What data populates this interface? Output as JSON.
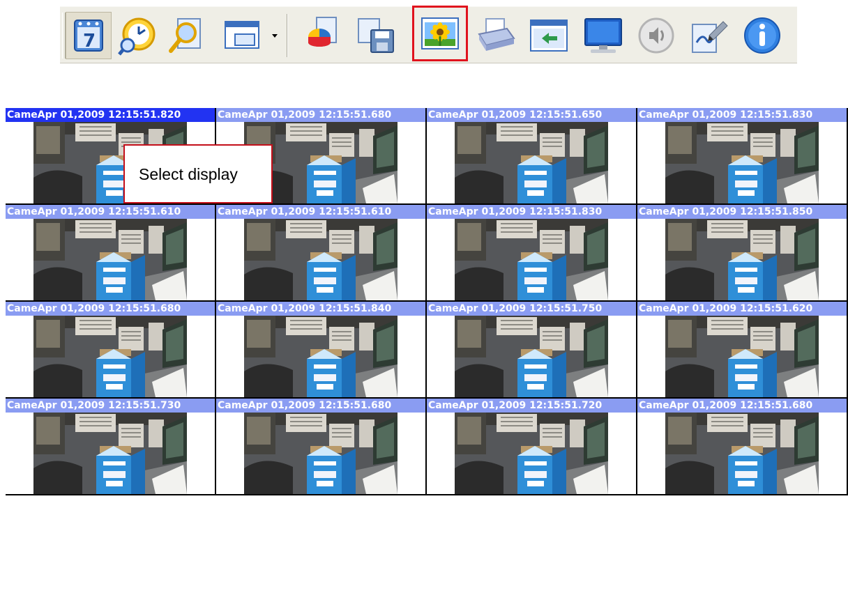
{
  "toolbar": {
    "buttons": [
      {
        "name": "calendar-playback-button",
        "icon": "calendar-icon",
        "state": "pressed"
      },
      {
        "name": "time-search-button",
        "icon": "clock-search-icon",
        "state": "normal"
      },
      {
        "name": "file-search-button",
        "icon": "magnifier-icon",
        "state": "normal"
      },
      {
        "name": "split-screen-button",
        "icon": "window-layout-icon",
        "state": "normal",
        "has_dropdown": true
      },
      {
        "name": "statistics-button",
        "icon": "pie-chart-icon",
        "state": "normal"
      },
      {
        "name": "backup-button",
        "icon": "save-disk-icon",
        "state": "normal"
      },
      {
        "name": "select-display-button",
        "icon": "sunflower-image-icon",
        "state": "highlighted"
      },
      {
        "name": "print-button",
        "icon": "printer-icon",
        "state": "normal"
      },
      {
        "name": "return-button",
        "icon": "return-arrow-icon",
        "state": "normal"
      },
      {
        "name": "monitor-button",
        "icon": "monitor-icon",
        "state": "normal"
      },
      {
        "name": "audio-button",
        "icon": "speaker-icon",
        "state": "normal"
      },
      {
        "name": "edit-note-button",
        "icon": "pencil-note-icon",
        "state": "normal"
      },
      {
        "name": "info-button",
        "icon": "info-icon",
        "state": "normal"
      }
    ]
  },
  "callout": {
    "text": "Select display"
  },
  "grid": {
    "selected_index": 0,
    "cells": [
      {
        "title": "CameApr 01,2009 12:15:51.820"
      },
      {
        "title": "CameApr 01,2009 12:15:51.680"
      },
      {
        "title": "CameApr 01,2009 12:15:51.650"
      },
      {
        "title": "CameApr 01,2009 12:15:51.830"
      },
      {
        "title": "CameApr 01,2009 12:15:51.610"
      },
      {
        "title": "CameApr 01,2009 12:15:51.610"
      },
      {
        "title": "CameApr 01,2009 12:15:51.830"
      },
      {
        "title": "CameApr 01,2009 12:15:51.850"
      },
      {
        "title": "CameApr 01,2009 12:15:51.680"
      },
      {
        "title": "CameApr 01,2009 12:15:51.840"
      },
      {
        "title": "CameApr 01,2009 12:15:51.750"
      },
      {
        "title": "CameApr 01,2009 12:15:51.620"
      },
      {
        "title": "CameApr 01,2009 12:15:51.730"
      },
      {
        "title": "CameApr 01,2009 12:15:51.680"
      },
      {
        "title": "CameApr 01,2009 12:15:51.720"
      },
      {
        "title": "CameApr 01,2009 12:15:51.680"
      }
    ]
  },
  "colors": {
    "title_bar": "#8a9cf2",
    "title_bar_selected": "#2233f2",
    "highlight_border": "#e0121d"
  }
}
